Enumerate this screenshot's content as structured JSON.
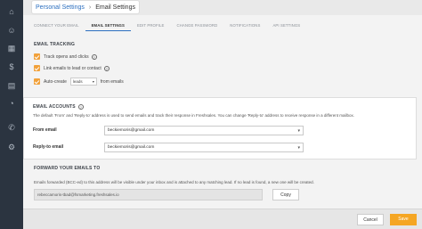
{
  "breadcrumb": {
    "parent": "Personal Settings",
    "current": "Email Settings"
  },
  "tabs": [
    {
      "label": "CONNECT YOUR EMAIL"
    },
    {
      "label": "EMAIL SETTINGS"
    },
    {
      "label": "EDIT PROFILE"
    },
    {
      "label": "CHANGE PASSWORD"
    },
    {
      "label": "NOTIFICATIONS"
    },
    {
      "label": "API SETTINGS"
    }
  ],
  "email_tracking": {
    "title": "EMAIL TRACKING",
    "track_label": "Track opens and clicks",
    "link_label": "Link emails to lead or contact",
    "auto_create_label": "Auto-create",
    "auto_create_value": "leads",
    "from_emails_label": "from emails"
  },
  "email_accounts": {
    "title": "EMAIL ACCOUNTS",
    "description": "The default 'From' and 'Reply-to' address is used to send emails and track their response in Freshsales. You can change 'Reply-to' address to receive response in a different mailbox.",
    "from_label": "From email",
    "from_value": "beckiemoris@gmail.com",
    "reply_label": "Reply-to email",
    "reply_value": "beckiemoris@gmail.com"
  },
  "forward": {
    "title": "FORWARD YOUR EMAILS TO",
    "description": "Emails forwarded (BCC-ed) to this address will be visible under your inbox and is attached to any matching lead. If no lead is found, a new one will be created.",
    "address": "rebeccamoris-tbad@fsmarketing.freshsales.io",
    "copy_label": "Copy"
  },
  "footer": {
    "cancel_label": "Cancel",
    "save_label": "Save"
  },
  "colors": {
    "accent": "#f5a623",
    "sidebar": "#2b3440",
    "link": "#2c6fbf"
  },
  "sidebar_icons": [
    "home-icon",
    "contacts-icon",
    "accounts-icon",
    "deals-icon",
    "calendar-icon",
    "reports-icon",
    "phone-icon",
    "settings-icon"
  ]
}
